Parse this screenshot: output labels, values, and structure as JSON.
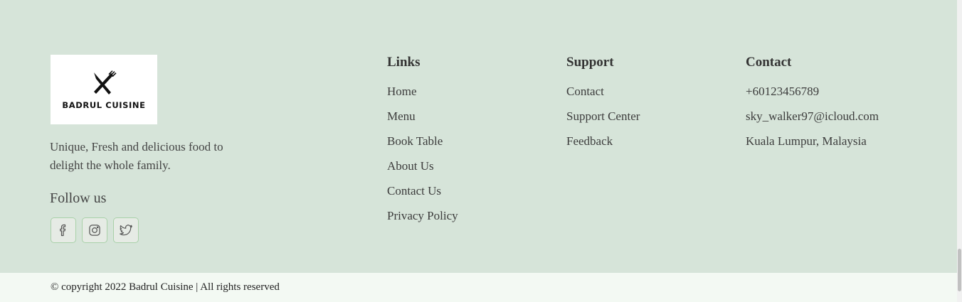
{
  "brand": {
    "logo_text": "BADRUL CUISINE",
    "logo_icon": "fork-knife-icon",
    "tagline": "Unique, Fresh and delicious food to delight the whole family."
  },
  "social": {
    "title": "Follow us",
    "items": [
      {
        "name": "facebook",
        "icon": "facebook-icon"
      },
      {
        "name": "instagram",
        "icon": "instagram-icon"
      },
      {
        "name": "twitter",
        "icon": "twitter-icon"
      }
    ],
    "border_color": "#a9d1a9"
  },
  "links": {
    "title": "Links",
    "items": [
      "Home",
      "Menu",
      "Book Table",
      "About Us",
      "Contact Us",
      "Privacy Policy"
    ]
  },
  "support": {
    "title": "Support",
    "items": [
      "Contact",
      "Support Center",
      "Feedback"
    ]
  },
  "contact": {
    "title": "Contact",
    "phone": "+60123456789",
    "email": "sky_walker97@icloud.com",
    "location": "Kuala Lumpur, Malaysia"
  },
  "copyright": "© copyright 2022 Badrul Cuisine | All rights reserved",
  "colors": {
    "footer_bg": "#d6e4d9",
    "copyright_bg": "#f3f9f3"
  }
}
